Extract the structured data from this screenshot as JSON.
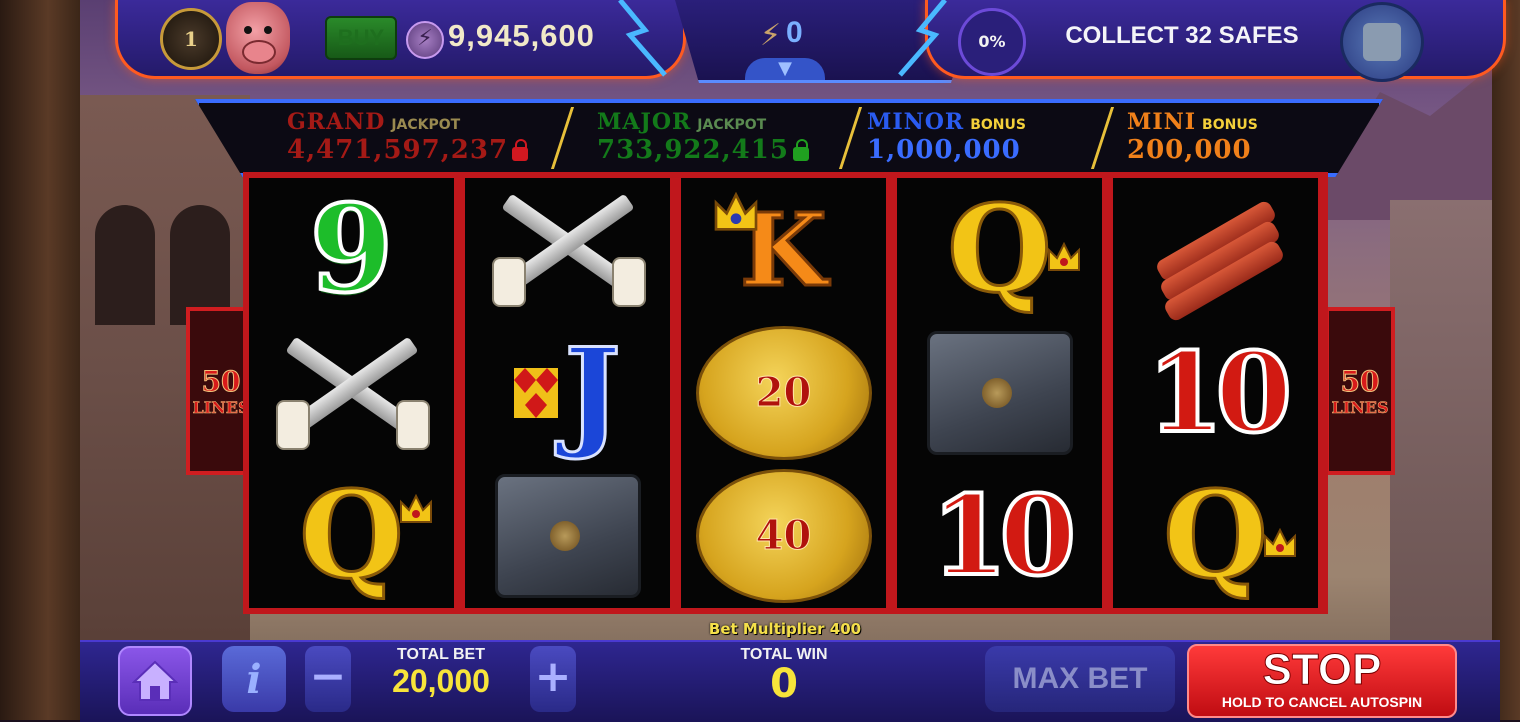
{
  "top_bar": {
    "level": "1",
    "buy_label": "BUY",
    "coin_balance": "9,945,600",
    "bolt_count": "0",
    "collect_progress": "0%",
    "collect_goal": "COLLECT 32 SAFES"
  },
  "jackpots": [
    {
      "name": "GRAND",
      "type": "JACKPOT",
      "value": "4,471,597,237",
      "color": "#a51a16",
      "locked": true
    },
    {
      "name": "MAJOR",
      "type": "JACKPOT",
      "value": "733,922,415",
      "color": "#137a1a",
      "locked": true
    },
    {
      "name": "MINOR",
      "type": "BONUS",
      "value": "1,000,000",
      "color": "#2a5bf0",
      "locked": false
    },
    {
      "name": "MINI",
      "type": "BONUS",
      "value": "200,000",
      "color": "#f0801a",
      "locked": false
    }
  ],
  "reels": [
    [
      "9",
      "crossed-pistols",
      "Q"
    ],
    [
      "crossed-pistols",
      "J",
      "safe"
    ],
    [
      "K",
      "gold-coin",
      "gold-coin"
    ],
    [
      "Q",
      "safe",
      "10"
    ],
    [
      "dynamite",
      "10",
      "Q"
    ]
  ],
  "coin_values": [
    "20",
    "40"
  ],
  "lines": {
    "count": "50",
    "label": "LINES"
  },
  "bet_multiplier": "Bet Multiplier 400",
  "bottom_bar": {
    "total_bet_label": "TOTAL BET",
    "total_bet_value": "20,000",
    "total_win_label": "TOTAL WIN",
    "total_win_value": "0",
    "max_bet_label": "MAX BET",
    "stop_label": "STOP",
    "stop_sublabel": "HOLD TO CANCEL AUTOSPIN"
  },
  "colors": {
    "frame_red": "#c0171c",
    "accent_blue": "#3a6cff",
    "stop_red": "#e01a1a",
    "value_yellow": "#f7e43a"
  }
}
